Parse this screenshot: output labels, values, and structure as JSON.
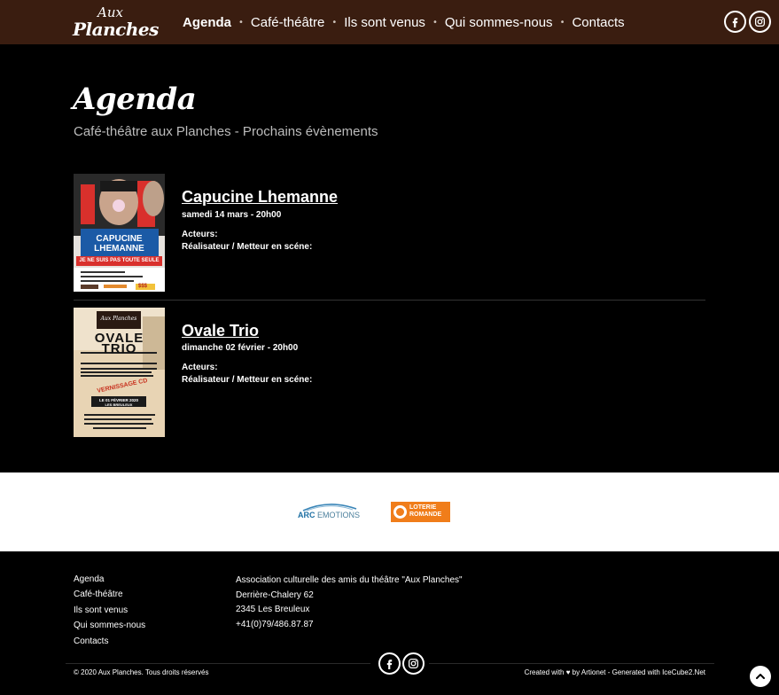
{
  "header": {
    "logo": {
      "line1": "Aux",
      "line2": "Planches"
    },
    "nav": [
      {
        "label": "Agenda",
        "active": true
      },
      {
        "label": "Café-théâtre",
        "active": false
      },
      {
        "label": "Ils sont venus",
        "active": false
      },
      {
        "label": "Qui sommes-nous",
        "active": false
      },
      {
        "label": "Contacts",
        "active": false
      }
    ],
    "social_icons": [
      "facebook-icon",
      "instagram-icon"
    ]
  },
  "page": {
    "title": "Agenda",
    "subtitle": "Café-théâtre aux Planches - Prochains évènements"
  },
  "events": [
    {
      "title": "Capucine Lhemanne",
      "date": "samedi 14 mars - 20h00",
      "actors_label": "Acteurs:",
      "director_label": "Réalisateur / Metteur en scéne:",
      "poster": {
        "line1": "CAPUCINE",
        "line2": "LHEMANNE",
        "banner": "JE NE SUIS PAS TOUTE SEULE",
        "price": "$$$"
      }
    },
    {
      "title": "Ovale Trio",
      "date": "dimanche 02 février - 20h00",
      "actors_label": "Acteurs:",
      "director_label": "Réalisateur / Metteur en scéne:",
      "poster": {
        "brand": "Aux Planches",
        "line1": "OVALE",
        "line2": "TRIO",
        "stamp": "VERNISSAGE CD",
        "date_line": "LE 01 FÉVRIER 2020",
        "place": "LES BREULEUX"
      }
    }
  ],
  "sponsors": {
    "arc": {
      "bold": "ARC",
      "rest": " EMOTIONS"
    },
    "loterie": {
      "line1": "LOTERIE",
      "line2": "ROMANDE"
    }
  },
  "footer": {
    "links": [
      "Agenda",
      "Café-théâtre",
      "Ils sont venus",
      "Qui sommes-nous",
      "Contacts"
    ],
    "address": [
      "Association culturelle des amis du théâtre \"Aux Planches\"",
      "Derrière-Chalery 62",
      "2345 Les Breuleux",
      "+41(0)79/486.87.87"
    ],
    "copyright": "© 2020 Aux Planches. Tous droits réservés",
    "credits": "Created with ♥ by Artionet - Generated with IceCube2.Net"
  },
  "colors": {
    "header_bg": "#3a1d10",
    "page_bg": "#000000",
    "loterie_orange": "#f07d1a",
    "arc_blue": "#1c6fa3"
  }
}
